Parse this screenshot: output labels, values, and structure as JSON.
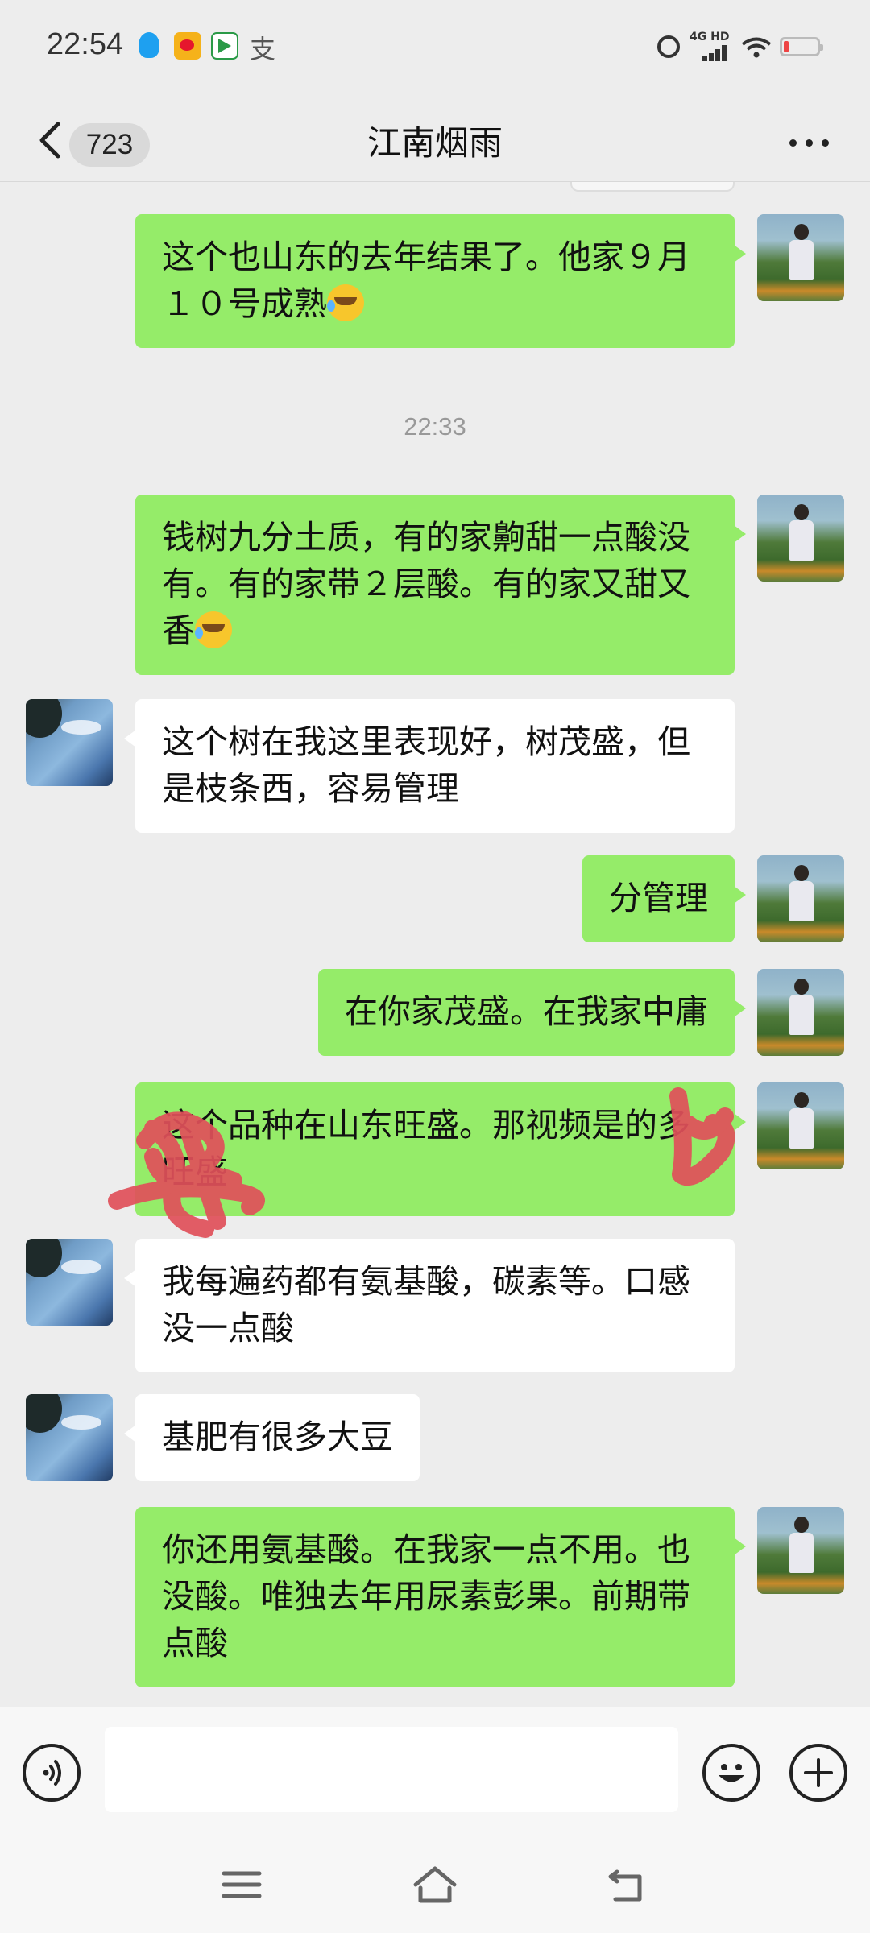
{
  "status_bar": {
    "time": "22:54",
    "extra_glyph": "支",
    "network": "4G HD",
    "icons": [
      "qq-icon",
      "weibo-icon",
      "video-app-icon",
      "alarm-icon",
      "signal-icon",
      "wifi-icon",
      "battery-low-icon"
    ],
    "battery_color": "#ee4444"
  },
  "nav": {
    "unread_count": "723",
    "title": "江南烟雨",
    "back_icon": "chevron-left-icon",
    "more_icon": "more-dots-icon"
  },
  "messages": [
    {
      "sender": "me",
      "text": "这个也山东的去年结果了。他家９月１０号成熟",
      "emoji": "rofl-emoji"
    },
    {
      "type": "time",
      "text": "22:33"
    },
    {
      "sender": "me",
      "text": "钱树九分土质，有的家齁甜一点酸没有。有的家带２层酸。有的家又甜又香",
      "emoji": "rofl-emoji"
    },
    {
      "sender": "friend",
      "text": "这个树在我这里表现好，树茂盛，但是枝条西，容易管理"
    },
    {
      "sender": "me",
      "text": "分管理"
    },
    {
      "sender": "me",
      "text": "在你家茂盛。在我家中庸"
    },
    {
      "sender": "me",
      "text": "这个品种在山东旺盛。那视频是的多旺盛",
      "note": "partially covered by red hand-drawn scribbles"
    },
    {
      "sender": "friend",
      "text": "我每遍药都有氨基酸，碳素等。口感没一点酸"
    },
    {
      "sender": "friend",
      "text": "基肥有很多大豆"
    },
    {
      "sender": "me",
      "text": "你还用氨基酸。在我家一点不用。也没酸。唯独去年用尿素彭果。前期带点酸"
    }
  ],
  "colors": {
    "outgoing_bubble": "#95ec69",
    "incoming_bubble": "#ffffff",
    "background": "#ededed",
    "scribble": "#e0505a"
  },
  "input_bar": {
    "placeholder": "",
    "voice_icon": "voice-icon",
    "emoji_icon": "smiley-icon",
    "plus_icon": "plus-circle-icon"
  },
  "system_nav": {
    "icons": [
      "menu-icon",
      "home-icon",
      "back-arrow-icon"
    ]
  }
}
